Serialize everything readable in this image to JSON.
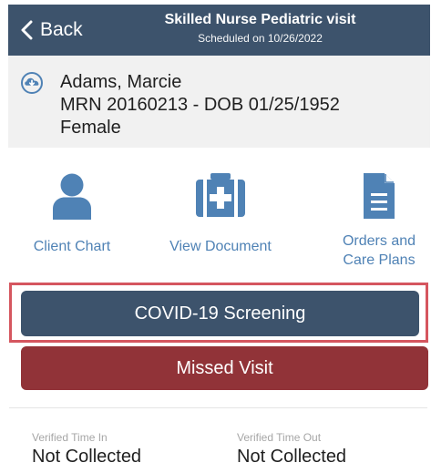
{
  "header": {
    "back_label": "Back",
    "title": "Skilled Nurse Pediatric visit",
    "subtitle": "Scheduled on 10/26/2022"
  },
  "patient": {
    "icon": "cloud-download-icon",
    "name": "Adams, Marcie",
    "details": "MRN 20160213 - DOB 01/25/1952",
    "gender": "Female"
  },
  "actions": [
    {
      "label": "Client Chart",
      "icon": "person-icon"
    },
    {
      "label": "View Document",
      "icon": "medical-kit-icon"
    },
    {
      "label": "Orders and\nCare Plans",
      "icon": "document-icon"
    }
  ],
  "buttons": {
    "covid_label": "COVID-19 Screening",
    "missed_label": "Missed Visit"
  },
  "visit_times": {
    "in_label": "Verified Time In",
    "in_value": "Not Collected",
    "out_label": "Verified Time Out",
    "out_value": "Not Collected"
  },
  "colors": {
    "header_bg": "#3d536c",
    "patient_bg": "#f1f1f1",
    "action_blue": "#4f82b5",
    "covid_highlight": "#d5565f",
    "missed_bg": "#913338"
  }
}
